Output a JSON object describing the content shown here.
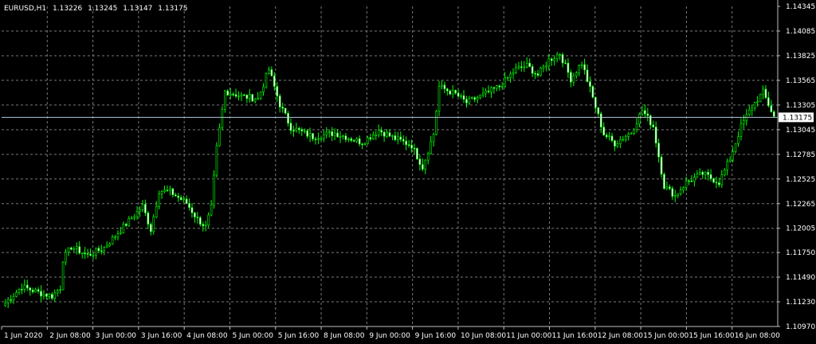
{
  "header": {
    "symbol": "EURUSD,H1",
    "open": "1.13226",
    "high": "1.13245",
    "low": "1.13147",
    "close": "1.13175"
  },
  "colors": {
    "background": "#000000",
    "grid": "#7a7a7a",
    "axis": "#c0c0c0",
    "candle": "#00ff00",
    "bull_body": "#000000",
    "bear_body": "#ffffff",
    "price_line": "#b4c8dc",
    "text": "#ffffff"
  },
  "chart_data": {
    "type": "candlestick",
    "title": "EURUSD,H1 1.13226 1.13245 1.13147 1.13175",
    "ylim": [
      1.1097,
      1.14345
    ],
    "y_ticks": [
      "1.14345",
      "1.14085",
      "1.13825",
      "1.13565",
      "1.13305",
      "1.13045",
      "1.12785",
      "1.12525",
      "1.12265",
      "1.12005",
      "1.11750",
      "1.11490",
      "1.11230",
      "1.10970"
    ],
    "x_ticks": [
      "1 Jun 2020",
      "2 Jun 08:00",
      "3 Jun 00:00",
      "3 Jun 16:00",
      "4 Jun 08:00",
      "5 Jun 00:00",
      "5 Jun 16:00",
      "8 Jun 08:00",
      "9 Jun 00:00",
      "9 Jun 16:00",
      "10 Jun 08:00",
      "11 Jun 00:00",
      "11 Jun 16:00",
      "12 Jun 08:00",
      "15 Jun 00:00",
      "15 Jun 16:00",
      "16 Jun 08:00"
    ],
    "current_price": "1.13175",
    "anchors": [
      [
        0,
        1.1122
      ],
      [
        6,
        1.1139
      ],
      [
        13,
        1.1132
      ],
      [
        17,
        1.1129
      ],
      [
        20,
        1.1138
      ],
      [
        21,
        1.1168
      ],
      [
        24,
        1.1181
      ],
      [
        30,
        1.1172
      ],
      [
        36,
        1.118
      ],
      [
        43,
        1.1202
      ],
      [
        50,
        1.1224
      ],
      [
        53,
        1.1199
      ],
      [
        56,
        1.124
      ],
      [
        60,
        1.1239
      ],
      [
        66,
        1.1227
      ],
      [
        70,
        1.121
      ],
      [
        73,
        1.1202
      ],
      [
        75,
        1.1222
      ],
      [
        77,
        1.1285
      ],
      [
        80,
        1.1345
      ],
      [
        86,
        1.134
      ],
      [
        92,
        1.1337
      ],
      [
        96,
        1.1368
      ],
      [
        100,
        1.1331
      ],
      [
        104,
        1.1307
      ],
      [
        112,
        1.1297
      ],
      [
        120,
        1.1301
      ],
      [
        130,
        1.1291
      ],
      [
        136,
        1.1304
      ],
      [
        142,
        1.1295
      ],
      [
        148,
        1.1288
      ],
      [
        152,
        1.1265
      ],
      [
        156,
        1.13
      ],
      [
        158,
        1.135
      ],
      [
        164,
        1.1342
      ],
      [
        168,
        1.1333
      ],
      [
        174,
        1.1341
      ],
      [
        180,
        1.135
      ],
      [
        186,
        1.1368
      ],
      [
        190,
        1.1372
      ],
      [
        194,
        1.1362
      ],
      [
        198,
        1.1378
      ],
      [
        202,
        1.1385
      ],
      [
        206,
        1.1358
      ],
      [
        210,
        1.1375
      ],
      [
        214,
        1.1338
      ],
      [
        218,
        1.13
      ],
      [
        222,
        1.129
      ],
      [
        228,
        1.1302
      ],
      [
        232,
        1.1325
      ],
      [
        236,
        1.1308
      ],
      [
        240,
        1.1245
      ],
      [
        244,
        1.1235
      ],
      [
        248,
        1.1249
      ],
      [
        254,
        1.1258
      ],
      [
        260,
        1.1249
      ],
      [
        264,
        1.1274
      ],
      [
        268,
        1.1308
      ],
      [
        272,
        1.1329
      ],
      [
        276,
        1.1344
      ],
      [
        280,
        1.1318
      ]
    ]
  }
}
